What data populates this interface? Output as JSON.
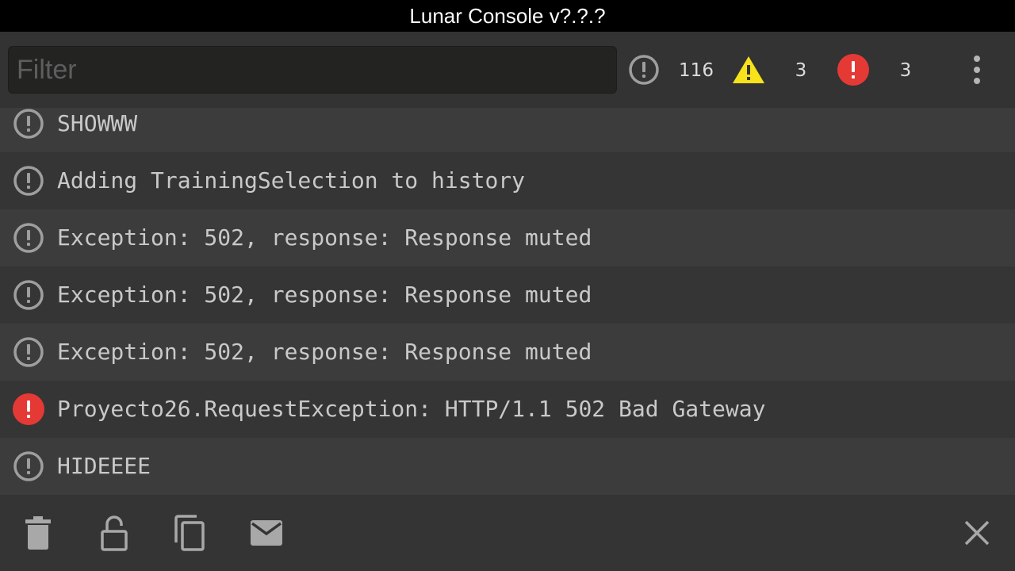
{
  "window": {
    "title": "Lunar Console v?.?.?"
  },
  "toolbar": {
    "filter_placeholder": "Filter",
    "filter_value": "",
    "counters": {
      "log": {
        "icon": "info-circle-icon",
        "count": "116"
      },
      "warning": {
        "icon": "warning-triangle-icon",
        "count": "3",
        "color": "#f7e21b"
      },
      "error": {
        "icon": "error-circle-icon",
        "count": "3",
        "color": "#e53935"
      }
    },
    "menu_icon": "more-vertical-icon"
  },
  "log": {
    "entries": [
      {
        "type": "log",
        "icon": "info-circle-icon",
        "message": "SHOWWW"
      },
      {
        "type": "log",
        "icon": "info-circle-icon",
        "message": "Adding TrainingSelection to history"
      },
      {
        "type": "log",
        "icon": "info-circle-icon",
        "message": "Exception: 502, response: Response muted"
      },
      {
        "type": "log",
        "icon": "info-circle-icon",
        "message": "Exception: 502, response: Response muted"
      },
      {
        "type": "log",
        "icon": "info-circle-icon",
        "message": "Exception: 502, response: Response muted"
      },
      {
        "type": "error",
        "icon": "error-circle-icon",
        "message": "Proyecto26.RequestException: HTTP/1.1 502 Bad Gateway"
      },
      {
        "type": "log",
        "icon": "info-circle-icon",
        "message": "HIDEEEE"
      }
    ]
  },
  "bottom_bar": {
    "actions": [
      "trash-icon",
      "lock-open-icon",
      "copy-icon",
      "email-icon"
    ],
    "close": "close-icon"
  },
  "colors": {
    "icon_gray": "#9e9e9e",
    "error_red": "#e53935",
    "warning_yellow": "#f7e21b",
    "text": "#c9c9c9"
  }
}
